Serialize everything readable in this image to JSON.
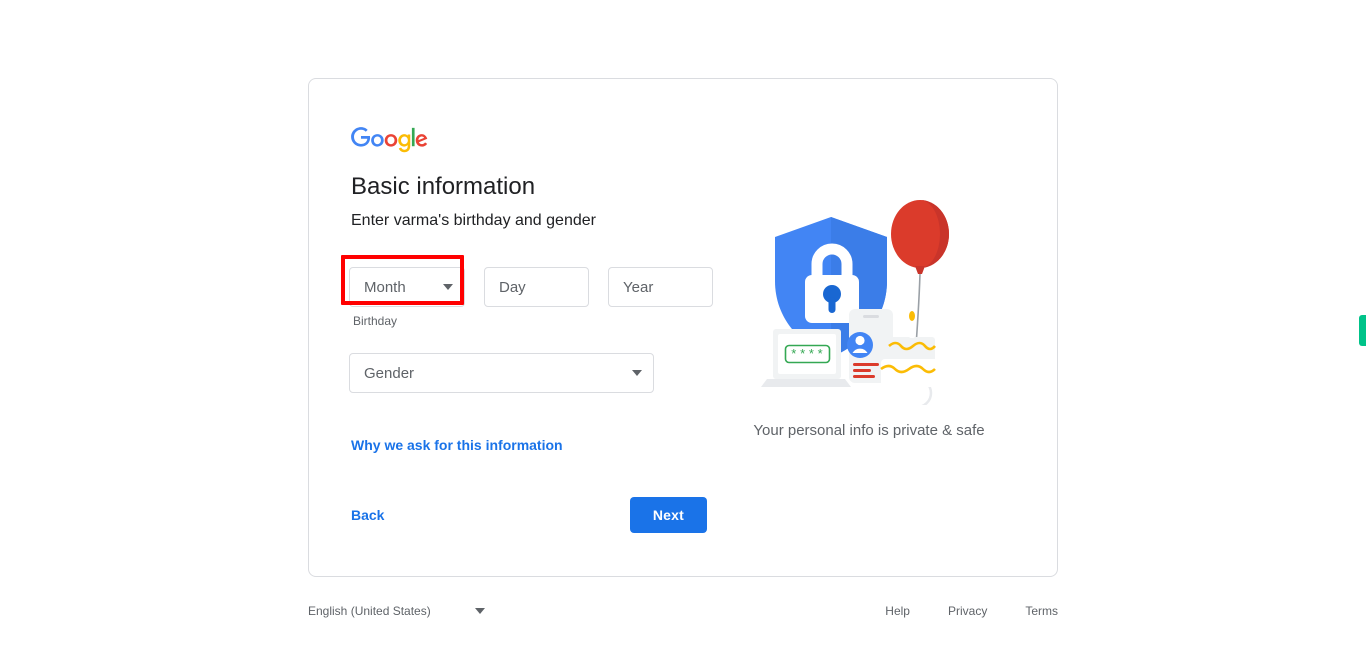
{
  "brand": {
    "logo_name": "google-logo",
    "letters": [
      "G",
      "o",
      "o",
      "g",
      "l",
      "e"
    ],
    "colors": {
      "blue": "#4285F4",
      "red": "#EA4335",
      "yellow": "#FBBC05",
      "green": "#34A853"
    }
  },
  "card": {
    "title": "Basic information",
    "subtitle": "Enter varma's birthday and gender"
  },
  "birthday": {
    "label": "Birthday",
    "month": {
      "placeholder": "Month",
      "value": "",
      "icon": "chevron-down-icon"
    },
    "day": {
      "placeholder": "Day",
      "value": ""
    },
    "year": {
      "placeholder": "Year",
      "value": ""
    }
  },
  "gender": {
    "placeholder": "Gender",
    "value": "",
    "icon": "chevron-down-icon"
  },
  "links": {
    "why_we_ask": "Why we ask for this information",
    "back": "Back"
  },
  "buttons": {
    "next": "Next"
  },
  "illustration": {
    "name": "privacy-shield-illustration",
    "caption": "Your personal info is private & safe",
    "colors": {
      "shield": "#4285F4",
      "lock": "#FFFFFF",
      "keyhole": "#1967D2",
      "balloon": "#DB3B2B",
      "cake_icing": "#FBBC05",
      "password_field": "#34A853",
      "device": "#F1F3F4"
    },
    "password_mask": "****"
  },
  "footer": {
    "language": "English (United States)",
    "language_icon": "chevron-down-icon",
    "links": [
      {
        "label": "Help"
      },
      {
        "label": "Privacy"
      },
      {
        "label": "Terms"
      }
    ]
  },
  "annotation": {
    "name": "red-highlight-box",
    "target": "month-dropdown",
    "color": "#FF0000"
  },
  "edge_tab": {
    "name": "side-tab",
    "color": "#00C389"
  }
}
